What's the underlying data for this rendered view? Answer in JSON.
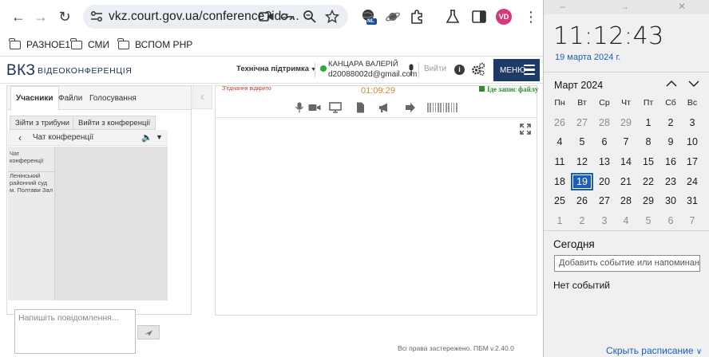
{
  "browser": {
    "url": "vkz.court.gov.ua/conference?id=...",
    "profile_initials": "VD",
    "ext_badge": "NL",
    "bookmarks": [
      "РАЗНОЕ1",
      "СМИ",
      "ВСПОМ РНР"
    ]
  },
  "app": {
    "logo": "ВКЗ",
    "logo_sub": "ВІДЕОКОНФЕРЕНЦІЯ",
    "support": "Технічна підтримка",
    "user_name": "КАНЦАРА ВАЛЕРІЙ",
    "user_email": "d20088002d@gmail.com",
    "logout": "Вийти",
    "menu": "МЕНЮ",
    "tabs": [
      "Учасники",
      "Файли",
      "Голосування"
    ],
    "subtabs": [
      "Зійти з трибуни",
      "Вийти з конференції"
    ],
    "chat": {
      "title": "Чат конференції",
      "list": [
        "Чат конференції",
        "Ленінський районний суд м. Полтави Зал"
      ],
      "placeholder": "Напишіть повідомлення..."
    },
    "conference": {
      "status": "З'єднання відкрито",
      "timer": "01:09:29",
      "recording": "Іде запис файлу"
    },
    "footer": "Всі права застережено. ПБМ v.2.40.0"
  },
  "flyout": {
    "time": "11:12:43",
    "date": "19 марта 2024 г.",
    "month": "Март 2024",
    "weekdays": [
      "Пн",
      "Вт",
      "Ср",
      "Чт",
      "Пт",
      "Сб",
      "Вс"
    ],
    "weeks": [
      [
        "26",
        "27",
        "28",
        "29",
        "1",
        "2",
        "3"
      ],
      [
        "4",
        "5",
        "6",
        "7",
        "8",
        "9",
        "10"
      ],
      [
        "11",
        "12",
        "13",
        "14",
        "15",
        "16",
        "17"
      ],
      [
        "18",
        "19",
        "20",
        "21",
        "22",
        "23",
        "24"
      ],
      [
        "25",
        "26",
        "27",
        "28",
        "29",
        "30",
        "31"
      ],
      [
        "1",
        "2",
        "3",
        "4",
        "5",
        "6",
        "7"
      ]
    ],
    "today_label": "Сегодня",
    "event_placeholder": "Добавить событие или напоминание",
    "no_events": "Нет событий",
    "hide_schedule": "Скрыть расписание"
  },
  "colors": {
    "brand_navy": "#1f3a64",
    "accent_blue": "#1a5fb4",
    "status_red": "#c0392b",
    "recording_green": "#2e8b2e",
    "timer_orange": "#d08a2b"
  }
}
